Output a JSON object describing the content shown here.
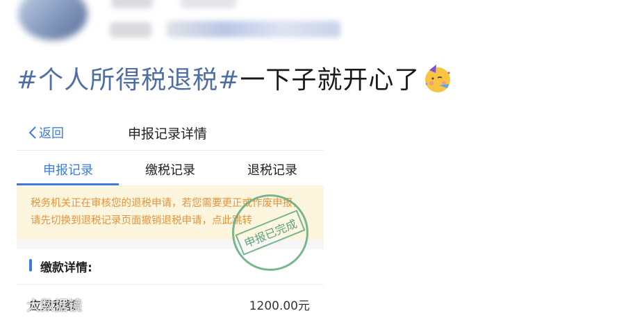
{
  "post": {
    "title_hashtag": "#个人所得税退税#",
    "title_text": "一下子就开心了",
    "emoji": "partying-face-emoji"
  },
  "card": {
    "back_label": "返回",
    "page_title": "申报记录详情",
    "tabs": [
      {
        "label": "申报记录",
        "active": true
      },
      {
        "label": "缴税记录",
        "active": false
      },
      {
        "label": "退税记录",
        "active": false
      }
    ],
    "notice": {
      "text": "税务机关正在审核您的退税申请，若您需要更正或作废申报，请先切换到退税记录页面撤销退税申请，",
      "link": "点此跳转"
    },
    "section_title": "缴款详情:",
    "rows": [
      {
        "label": "应退税额",
        "value": "1200.00元"
      }
    ],
    "stamp_text": "申报已完成"
  },
  "watermark": {
    "text": "大数据镜"
  },
  "colors": {
    "accent": "#3c7cdc",
    "hashtag": "#4f6fa2",
    "notice_bg": "#fdf5dd",
    "notice_text": "#e5933c",
    "stamp": "#5faa7d"
  }
}
